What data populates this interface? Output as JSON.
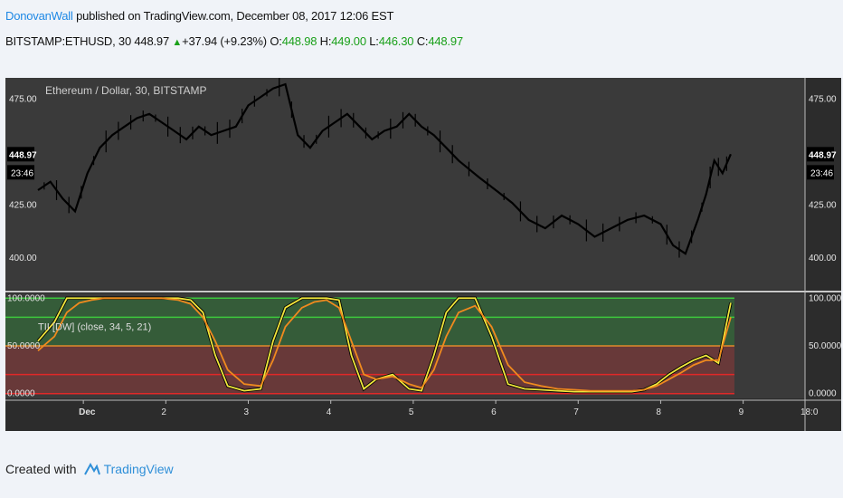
{
  "header": {
    "author": "DonovanWall",
    "published": "published on TradingView.com, December 08, 2017 12:06 EST",
    "symbol": "BITSTAMP:ETHUSD, 30",
    "last": "448.97",
    "change": "+37.94 (+9.23%)",
    "o_label": "O:",
    "o_value": "448.98",
    "h_label": "H:",
    "h_value": "449.00",
    "l_label": "L:",
    "l_value": "446.30",
    "c_label": "C:",
    "c_value": "448.97"
  },
  "footer": {
    "created_with": "Created with",
    "brand": "TradingView"
  },
  "colors": {
    "pane_bg": "#3a3a3a",
    "candle": "#000000",
    "axis_text": "#e6e6e6",
    "green_zone": "#2e9e3a",
    "red_zone": "#a23a3a",
    "fast_line": "#f0e63c",
    "slow_line": "#f08a1e",
    "level_green": "#3cc83c",
    "level_orange": "#e08a2a",
    "level_red": "#e02828"
  },
  "chart_data": [
    {
      "type": "candlestick",
      "title": "Ethereum / Dollar, 30, BITSTAMP",
      "ylim": [
        385,
        485
      ],
      "yticks": [
        "475.00",
        "425.00",
        "400.00"
      ],
      "last_price_label": "448.97",
      "countdown_label": "23:46",
      "xlim": [
        0,
        9.3
      ],
      "xticks": [
        {
          "x": 0.55,
          "label": "Dec"
        },
        {
          "x": 1.55,
          "label": "2"
        },
        {
          "x": 2.55,
          "label": "3"
        },
        {
          "x": 3.55,
          "label": "4"
        },
        {
          "x": 4.55,
          "label": "5"
        },
        {
          "x": 5.55,
          "label": "6"
        },
        {
          "x": 6.55,
          "label": "7"
        },
        {
          "x": 7.55,
          "label": "8"
        },
        {
          "x": 8.55,
          "label": "9"
        },
        {
          "x": 9.3,
          "label": "18:0"
        }
      ],
      "series": [
        {
          "x": [
            0.0,
            0.15,
            0.3,
            0.45,
            0.6,
            0.75,
            0.9,
            1.05,
            1.2,
            1.35,
            1.5,
            1.65,
            1.8,
            1.95,
            2.1,
            2.25,
            2.4,
            2.55,
            2.7,
            2.85,
            3.0,
            3.15,
            3.3,
            3.45,
            3.6,
            3.75,
            3.9,
            4.05,
            4.2,
            4.35,
            4.5,
            4.65,
            4.8,
            4.95,
            5.1,
            5.35,
            5.55,
            5.75,
            5.95,
            6.15,
            6.35,
            6.55,
            6.75,
            6.95,
            7.15,
            7.35,
            7.55,
            7.7,
            7.85,
            8.0,
            8.1,
            8.2,
            8.3,
            8.4
          ],
          "y": [
            432,
            436,
            428,
            422,
            440,
            452,
            458,
            462,
            466,
            468,
            464,
            460,
            456,
            462,
            458,
            460,
            462,
            472,
            476,
            480,
            482,
            458,
            452,
            460,
            464,
            468,
            462,
            456,
            460,
            462,
            468,
            462,
            458,
            452,
            446,
            438,
            432,
            426,
            418,
            414,
            420,
            416,
            410,
            414,
            418,
            420,
            416,
            406,
            402,
            418,
            430,
            446,
            440,
            448.97
          ]
        }
      ]
    },
    {
      "type": "line",
      "title": "TII [DW] (close, 34, 5, 21)",
      "ylim": [
        -5,
        105
      ],
      "yticks": [
        "100.0000",
        "50.0000",
        "0.0000"
      ],
      "levels": [
        100,
        80,
        50,
        20,
        0
      ],
      "series": [
        {
          "values_x": [
            0.0,
            0.2,
            0.35,
            0.5,
            0.65,
            0.8,
            1.0,
            1.3,
            1.5,
            1.7,
            1.85,
            2.0,
            2.15,
            2.3,
            2.5,
            2.7,
            2.85,
            3.0,
            3.2,
            3.35,
            3.5,
            3.65,
            3.8,
            3.95,
            4.1,
            4.3,
            4.5,
            4.65,
            4.8,
            4.95,
            5.1,
            5.3,
            5.5,
            5.7,
            5.9,
            6.1,
            6.3,
            6.5,
            6.7,
            6.9,
            7.05,
            7.2,
            7.35,
            7.5,
            7.65,
            7.8,
            7.95,
            8.1,
            8.25,
            8.4
          ],
          "values_y": [
            55,
            75,
            100,
            100,
            100,
            100,
            100,
            100,
            100,
            100,
            98,
            85,
            40,
            8,
            3,
            5,
            55,
            90,
            100,
            100,
            100,
            98,
            40,
            5,
            15,
            20,
            5,
            3,
            40,
            85,
            100,
            100,
            60,
            10,
            5,
            4,
            3,
            2,
            2,
            2,
            2,
            2,
            4,
            10,
            20,
            28,
            35,
            40,
            32,
            95
          ]
        },
        {
          "values_x": [
            0.0,
            0.2,
            0.35,
            0.5,
            0.65,
            0.8,
            1.0,
            1.3,
            1.5,
            1.7,
            1.85,
            2.0,
            2.15,
            2.3,
            2.5,
            2.7,
            2.85,
            3.0,
            3.2,
            3.35,
            3.5,
            3.65,
            3.8,
            3.95,
            4.1,
            4.3,
            4.5,
            4.65,
            4.8,
            4.95,
            5.1,
            5.3,
            5.5,
            5.7,
            5.9,
            6.1,
            6.3,
            6.5,
            6.7,
            6.9,
            7.05,
            7.2,
            7.35,
            7.5,
            7.65,
            7.8,
            7.95,
            8.1,
            8.25,
            8.4
          ],
          "values_y": [
            45,
            60,
            85,
            95,
            98,
            100,
            100,
            100,
            100,
            98,
            94,
            80,
            55,
            25,
            10,
            8,
            35,
            70,
            90,
            96,
            98,
            90,
            55,
            20,
            15,
            18,
            10,
            6,
            25,
            60,
            85,
            92,
            70,
            30,
            12,
            8,
            5,
            4,
            3,
            3,
            3,
            3,
            4,
            8,
            15,
            22,
            30,
            35,
            35,
            80
          ]
        }
      ]
    }
  ]
}
